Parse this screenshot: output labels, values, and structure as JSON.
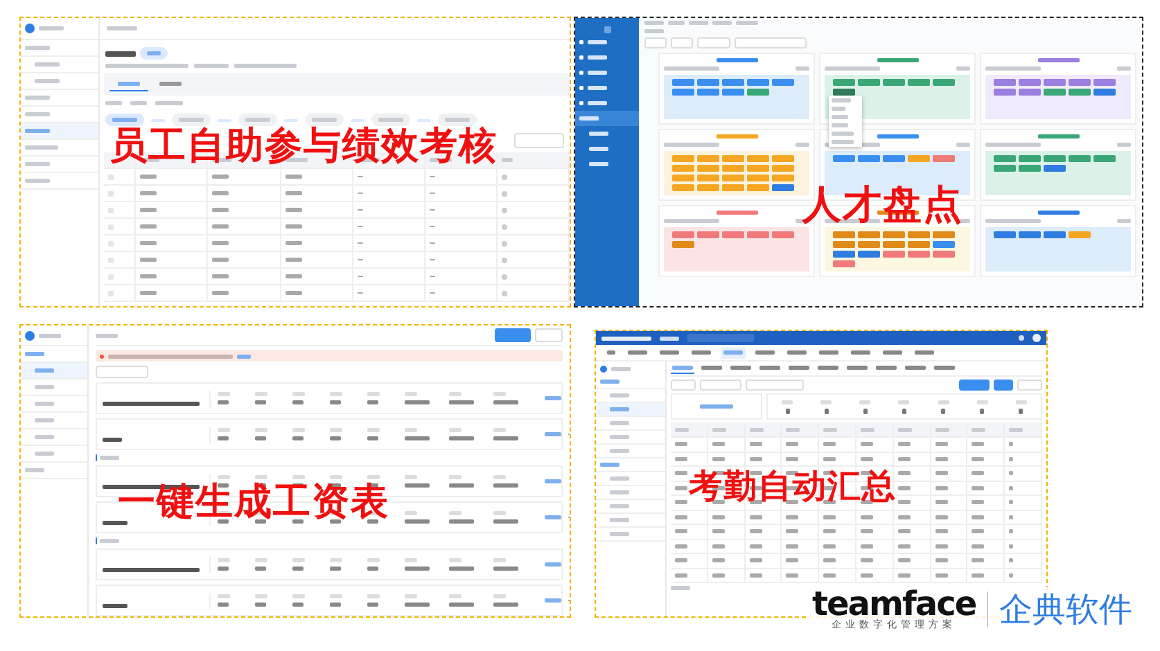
{
  "panels": [
    {
      "kind": "performance",
      "caption": "员工自助参与绩效考核",
      "sidebar": [
        {
          "selected": false
        },
        {
          "selected": false
        },
        {
          "selected": false
        },
        {
          "selected": false
        },
        {
          "selected": false
        },
        {
          "selected": true
        },
        {
          "selected": false
        },
        {
          "selected": false
        },
        {
          "selected": false
        }
      ],
      "tabs": [
        {
          "selected": true
        },
        {
          "selected": false
        }
      ],
      "steps": [
        {
          "selected": true
        },
        {
          "selected": false
        },
        {
          "selected": false
        },
        {
          "selected": false
        },
        {
          "selected": false
        },
        {
          "selected": false
        }
      ],
      "rows": [
        {
          "checked": false
        },
        {
          "checked": false
        },
        {
          "checked": false
        },
        {
          "checked": false
        },
        {
          "checked": false
        },
        {
          "checked": false
        },
        {
          "checked": false
        },
        {
          "checked": false
        }
      ]
    },
    {
      "kind": "talent",
      "caption": "人才盘点",
      "menu": [
        {
          "selected": false
        },
        {
          "selected": false
        },
        {
          "selected": false
        },
        {
          "selected": false
        },
        {
          "selected": false
        },
        {
          "selected": true
        },
        {
          "selected": false
        },
        {
          "selected": false
        },
        {
          "selected": false
        }
      ],
      "cards": [
        {
          "color": "#dcecfb",
          "chips": [
            {
              "color": "#3a8ef0"
            },
            {
              "color": "#3a8ef0"
            },
            {
              "color": "#3a8ef0"
            },
            {
              "color": "#3a8ef0"
            },
            {
              "color": "#3a8ef0"
            },
            {
              "color": "#3a8ef0"
            },
            {
              "color": "#3a8ef0"
            },
            {
              "color": "#3a8ef0"
            },
            {
              "color": "#3aa776"
            }
          ]
        },
        {
          "color": "#dcf2e8",
          "chips": [
            {
              "color": "#3aa776"
            },
            {
              "color": "#3aa776"
            },
            {
              "color": "#3aa776"
            },
            {
              "color": "#3aa776"
            },
            {
              "color": "#3aa776"
            },
            {
              "color": "#2f7d5a"
            }
          ],
          "menu_open": true
        },
        {
          "color": "#efeafd",
          "chips": [
            {
              "color": "#9a7fe0"
            },
            {
              "color": "#9a7fe0"
            },
            {
              "color": "#9a7fe0"
            },
            {
              "color": "#9a7fe0"
            },
            {
              "color": "#9a7fe0"
            },
            {
              "color": "#9a7fe0"
            },
            {
              "color": "#9a7fe0"
            },
            {
              "color": "#3aa776"
            },
            {
              "color": "#3aa776"
            },
            {
              "color": "#2f7de0"
            }
          ]
        },
        {
          "color": "#fdf3dc",
          "chips": [
            {
              "color": "#f5a623"
            },
            {
              "color": "#f5a623"
            },
            {
              "color": "#f5a623"
            },
            {
              "color": "#f5a623"
            },
            {
              "color": "#f5a623"
            },
            {
              "color": "#f5a623"
            },
            {
              "color": "#f5a623"
            },
            {
              "color": "#f5a623"
            },
            {
              "color": "#f5a623"
            },
            {
              "color": "#f5a623"
            },
            {
              "color": "#f5a623"
            },
            {
              "color": "#f5a623"
            },
            {
              "color": "#f5a623"
            },
            {
              "color": "#f5a623"
            },
            {
              "color": "#f5a623"
            },
            {
              "color": "#f5a623"
            },
            {
              "color": "#f5a623"
            },
            {
              "color": "#f5a623"
            },
            {
              "color": "#f5a623"
            },
            {
              "color": "#2f7de0"
            }
          ]
        },
        {
          "color": "#dcecfb",
          "chips": [
            {
              "color": "#3a8ef0"
            },
            {
              "color": "#3a8ef0"
            },
            {
              "color": "#3a8ef0"
            },
            {
              "color": "#f5a623"
            },
            {
              "color": "#f07a7a"
            }
          ]
        },
        {
          "color": "#dcf2e8",
          "chips": [
            {
              "color": "#3aa776"
            },
            {
              "color": "#3aa776"
            },
            {
              "color": "#3aa776"
            },
            {
              "color": "#3aa776"
            },
            {
              "color": "#3aa776"
            },
            {
              "color": "#3aa776"
            },
            {
              "color": "#3aa776"
            },
            {
              "color": "#2f7de0"
            }
          ]
        },
        {
          "color": "#fde4e4",
          "chips": [
            {
              "color": "#f07a7a"
            },
            {
              "color": "#f07a7a"
            },
            {
              "color": "#f07a7a"
            },
            {
              "color": "#f07a7a"
            },
            {
              "color": "#f07a7a"
            },
            {
              "color": "#e08a1a"
            }
          ]
        },
        {
          "color": "#fdf6e0",
          "chips": [
            {
              "color": "#e08a1a"
            },
            {
              "color": "#e08a1a"
            },
            {
              "color": "#e08a1a"
            },
            {
              "color": "#e08a1a"
            },
            {
              "color": "#e08a1a"
            },
            {
              "color": "#e08a1a"
            },
            {
              "color": "#e08a1a"
            },
            {
              "color": "#e08a1a"
            },
            {
              "color": "#e08a1a"
            },
            {
              "color": "#3a8ef0"
            },
            {
              "color": "#2f7de0"
            },
            {
              "color": "#2f7de0"
            },
            {
              "color": "#f07a7a"
            },
            {
              "color": "#f07a7a"
            },
            {
              "color": "#f07a7a"
            },
            {
              "color": "#f07a7a"
            }
          ]
        },
        {
          "color": "#dcecfb",
          "chips": [
            {
              "color": "#2f7de0"
            },
            {
              "color": "#2f7de0"
            },
            {
              "color": "#2f7de0"
            },
            {
              "color": "#f5a623"
            }
          ]
        }
      ]
    },
    {
      "kind": "payroll",
      "caption": "一键生成工资表",
      "sidebar": [
        {
          "selected": false
        },
        {
          "selected": true
        },
        {
          "selected": false
        },
        {
          "selected": false
        },
        {
          "selected": false
        },
        {
          "selected": false
        },
        {
          "selected": false
        },
        {
          "selected": false
        }
      ]
    },
    {
      "kind": "attendance",
      "caption": "考勤自动汇总",
      "nav": [
        {
          "selected": false
        },
        {
          "selected": false
        },
        {
          "selected": false
        },
        {
          "selected": false
        },
        {
          "selected": true
        },
        {
          "selected": false
        },
        {
          "selected": false
        },
        {
          "selected": false
        },
        {
          "selected": false
        },
        {
          "selected": false
        },
        {
          "selected": false
        }
      ],
      "sub_tabs": [
        {
          "selected": true
        },
        {
          "selected": false
        },
        {
          "selected": false
        },
        {
          "selected": false
        },
        {
          "selected": false
        },
        {
          "selected": false
        },
        {
          "selected": false
        },
        {
          "selected": false
        },
        {
          "selected": false
        },
        {
          "selected": false
        }
      ],
      "sidebar": [
        {
          "selected": false
        },
        {
          "selected": false
        },
        {
          "selected": true
        },
        {
          "selected": false
        },
        {
          "selected": false
        },
        {
          "selected": false
        },
        {
          "selected": false
        },
        {
          "selected": false
        },
        {
          "selected": false
        },
        {
          "selected": false
        },
        {
          "selected": false
        },
        {
          "selected": false
        }
      ]
    }
  ],
  "brand": {
    "name": "teamface",
    "chinese": "企典软件",
    "tagline": "企业数字化管理方案"
  }
}
